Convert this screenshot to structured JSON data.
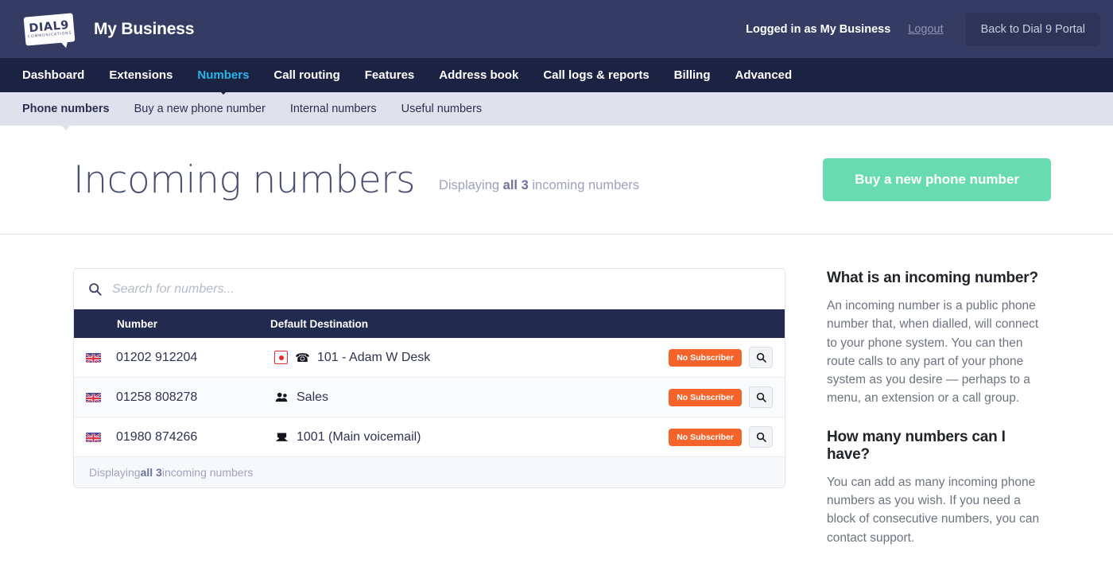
{
  "header": {
    "logo_main": "DIAL9",
    "logo_sub": "COMMUNICATIONS",
    "logo_name": "dial9-communications-logo",
    "brand_title": "My Business",
    "logged_in_text": "Logged in as My Business",
    "logout_label": "Logout",
    "portal_button_label": "Back to Dial 9 Portal",
    "bg_color": "#353c63"
  },
  "main_nav": {
    "bg_color": "#1c2242",
    "active_color": "#29b5e8",
    "items": [
      {
        "label": "Dashboard",
        "active": false
      },
      {
        "label": "Extensions",
        "active": false
      },
      {
        "label": "Numbers",
        "active": true
      },
      {
        "label": "Call routing",
        "active": false
      },
      {
        "label": "Features",
        "active": false
      },
      {
        "label": "Address book",
        "active": false
      },
      {
        "label": "Call logs & reports",
        "active": false
      },
      {
        "label": "Billing",
        "active": false
      },
      {
        "label": "Advanced",
        "active": false
      }
    ]
  },
  "sub_nav": {
    "bg_color": "#dfe1ec",
    "items": [
      {
        "label": "Phone numbers",
        "active": true
      },
      {
        "label": "Buy a new phone number",
        "active": false
      },
      {
        "label": "Internal numbers",
        "active": false
      },
      {
        "label": "Useful numbers",
        "active": false
      }
    ]
  },
  "page": {
    "title": "Incoming numbers",
    "subtitle_prefix": "Displaying ",
    "subtitle_strong": "all 3",
    "subtitle_suffix": " incoming numbers",
    "buy_button_label": "Buy a new phone number",
    "buy_button_color": "#68dcb0"
  },
  "search": {
    "placeholder": "Search for numbers...",
    "value": "",
    "icon": "search-icon"
  },
  "table": {
    "header_bg": "#232a4f",
    "columns": [
      "Number",
      "Default Destination"
    ],
    "rows": [
      {
        "flag": "uk-flag-icon",
        "number": "01202 912204",
        "recording": true,
        "recording_icon": "call-recording-icon",
        "dest_icon": "telephone-icon",
        "dest_glyph": "☎",
        "destination": "101 - Adam W Desk",
        "badge": "No Subscriber",
        "badge_color": "#f4642a",
        "action_icon": "magnifier-icon"
      },
      {
        "flag": "uk-flag-icon",
        "number": "01258 808278",
        "recording": false,
        "recording_icon": "",
        "dest_icon": "group-icon",
        "dest_glyph": "👥",
        "destination": "Sales",
        "badge": "No Subscriber",
        "badge_color": "#f4642a",
        "action_icon": "magnifier-icon"
      },
      {
        "flag": "uk-flag-icon",
        "number": "01980 874266",
        "recording": false,
        "recording_icon": "",
        "dest_icon": "voicemail-inbox-icon",
        "dest_glyph": "✉",
        "destination": "1001 (Main voicemail)",
        "badge": "No Subscriber",
        "badge_color": "#f4642a",
        "action_icon": "magnifier-icon"
      }
    ],
    "footer_prefix": "Displaying ",
    "footer_strong": "all 3",
    "footer_suffix": " incoming numbers"
  },
  "help": [
    {
      "heading": "What is an incoming number?",
      "body": "An incoming number is a public phone number that, when dialled, will connect to your phone system. You can then route calls to any part of your phone system as you desire — perhaps to a menu, an extension or a call group."
    },
    {
      "heading": "How many numbers can I have?",
      "body": "You can add as many incoming phone numbers as you wish. If you need a block of consecutive numbers, you can contact support."
    }
  ]
}
